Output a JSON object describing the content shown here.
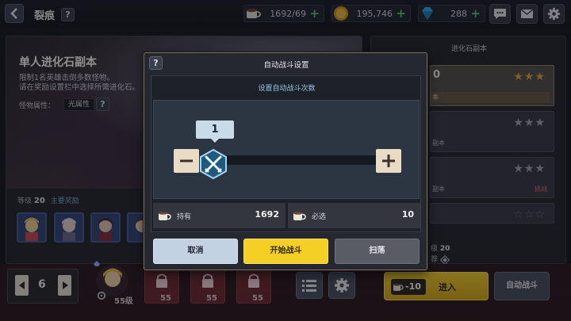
{
  "header": {
    "title": "裂痕",
    "resources": [
      {
        "icon": "coffee-cup-icon",
        "value": "1692/69"
      },
      {
        "icon": "gold-coin-icon",
        "value": "195,746"
      },
      {
        "icon": "blue-gem-icon",
        "value": "288"
      }
    ]
  },
  "dungeon": {
    "title": "单人进化石副本",
    "desc_line1": "限制1名英雄击倒多数怪物。",
    "desc_line2": "请在奖励设置栏中选择所需进化石。",
    "attr_label": "怪物属性：",
    "attr_value": "光属性",
    "level_label": "等级",
    "level_value": "20",
    "rewards_label": "主要奖励"
  },
  "right_panel": {
    "title": "进化石副本",
    "stages": [
      {
        "name": "0",
        "stars": "★★★",
        "sub": "本",
        "tag": "",
        "active": true
      },
      {
        "name": "",
        "stars": "★★★",
        "sub": "副本",
        "tag": "",
        "active": false
      },
      {
        "name": "",
        "stars": "★★★",
        "sub": "副本",
        "tag": "挑战",
        "active": false
      },
      {
        "name": "",
        "stars": "☆☆☆",
        "sub": "",
        "tag": "",
        "active": false
      }
    ],
    "lv_label": "级",
    "lv_value": "20",
    "rec_label": "荐"
  },
  "team": {
    "number": "6",
    "hero_levels": [
      "55级",
      "55",
      "55",
      "55"
    ]
  },
  "bottom": {
    "enter_cost": "-10",
    "enter_label": "进入",
    "auto_label": "自动战斗"
  },
  "modal": {
    "title": "自动战斗设置",
    "subtitle": "设置自动战斗次数",
    "count": "1",
    "count_fraction": 0.0,
    "owned_label": "持有",
    "owned_value": "1692",
    "required_label": "必选",
    "required_value": "10",
    "cancel_label": "取消",
    "start_label": "开始战斗",
    "sweep_label": "扫荡"
  },
  "colors": {
    "accent_yellow": "#f5cf23",
    "cancel_blue": "#c2d2e3",
    "slider_panel": "#2c3542",
    "star_gold": "#d9a84a"
  }
}
